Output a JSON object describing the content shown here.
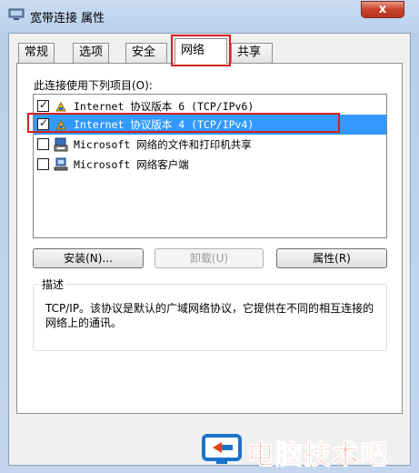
{
  "window": {
    "title": "宽带连接 属性",
    "close_label": "x"
  },
  "tabs": [
    {
      "label": "常规"
    },
    {
      "label": "选项"
    },
    {
      "label": "安全"
    },
    {
      "label": "网络",
      "active": true
    },
    {
      "label": "共享"
    }
  ],
  "network": {
    "connect_label": "此连接使用下列项目(O):",
    "items": [
      {
        "label": "Internet 协议版本 6 (TCP/IPv6)",
        "checked": true,
        "icon": "protocol-icon"
      },
      {
        "label": "Internet 协议版本 4 (TCP/IPv4)",
        "checked": true,
        "selected": true,
        "icon": "protocol-icon"
      },
      {
        "label": "Microsoft 网络的文件和打印机共享",
        "checked": false,
        "icon": "printer-network-icon"
      },
      {
        "label": "Microsoft 网络客户端",
        "checked": false,
        "icon": "network-client-icon"
      }
    ],
    "buttons": {
      "install": "安装(N)...",
      "uninstall": "卸载(U)",
      "properties": "属性(R)"
    },
    "description_title": "描述",
    "description": "TCP/IP。该协议是默认的广域网络协议，它提供在不同的相互连接的网络上的通讯。"
  },
  "watermark": {
    "text": "电脑技术吧"
  },
  "colors": {
    "selection": "#3399ff",
    "highlight": "#d42020",
    "watermark": "#e8431c"
  }
}
